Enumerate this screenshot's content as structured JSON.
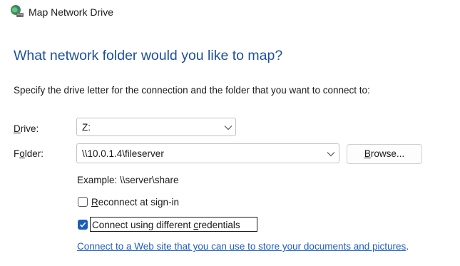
{
  "window": {
    "title": "Map Network Drive",
    "icon": "network-drive-icon"
  },
  "heading": "What network folder would you like to map?",
  "instruction": "Specify the drive letter for the connection and the folder that you want to connect to:",
  "drive": {
    "label_key": "D",
    "label_rest": "rive:",
    "value": "Z:",
    "icon": "chevron-down-icon"
  },
  "folder": {
    "label_pre": "F",
    "label_key": "o",
    "label_rest": "lder:",
    "value": "\\\\10.0.1.4\\fileserver",
    "icon": "chevron-down-icon"
  },
  "browse_button": {
    "label_key": "B",
    "label_rest": "rowse..."
  },
  "example_text": "Example: \\\\server\\share",
  "reconnect": {
    "checked": false,
    "label_key": "R",
    "label_rest": "econnect at sign-in"
  },
  "credentials": {
    "checked": true,
    "label_pre": "Connect using different ",
    "label_key": "c",
    "label_rest": "redentials"
  },
  "web_link": {
    "text": "Connect to a Web site that you can use to store your documents and pictures",
    "trailing": "."
  },
  "colors": {
    "heading": "#1e4f9c",
    "link": "#1f5fbf",
    "checkbox_checked": "#1a5fb4"
  }
}
